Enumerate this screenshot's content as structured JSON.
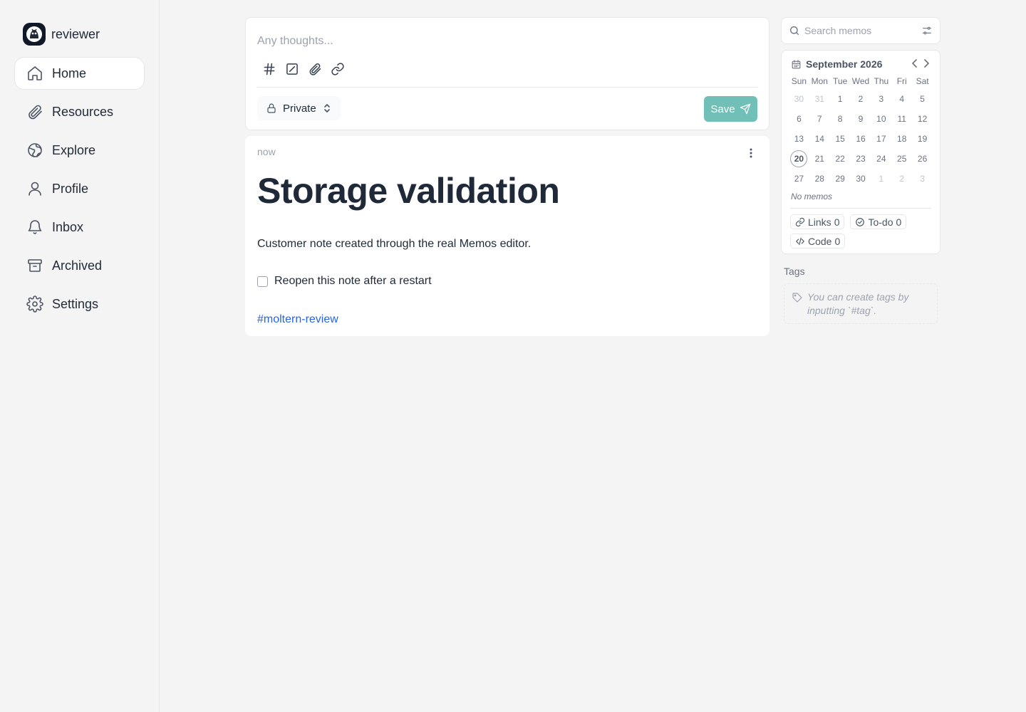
{
  "user": {
    "name": "reviewer"
  },
  "nav": {
    "items": [
      {
        "label": "Home",
        "icon": "home-icon",
        "active": true
      },
      {
        "label": "Resources",
        "icon": "paperclip-icon"
      },
      {
        "label": "Explore",
        "icon": "globe-icon"
      },
      {
        "label": "Profile",
        "icon": "user-icon"
      },
      {
        "label": "Inbox",
        "icon": "bell-icon"
      },
      {
        "label": "Archived",
        "icon": "archive-icon"
      },
      {
        "label": "Settings",
        "icon": "gear-icon"
      }
    ]
  },
  "editor": {
    "placeholder": "Any thoughts...",
    "visibility": "Private",
    "save_label": "Save"
  },
  "memo": {
    "time": "now",
    "title": "Storage validation",
    "body": "Customer note created through the real Memos editor.",
    "task": "Reopen this note after a restart",
    "task_checked": false,
    "tag": "#moltern-review"
  },
  "search": {
    "placeholder": "Search memos"
  },
  "calendar": {
    "month_label": "September 2026",
    "weekdays": [
      "Sun",
      "Mon",
      "Tue",
      "Wed",
      "Thu",
      "Fri",
      "Sat"
    ],
    "weeks": [
      [
        "30",
        "31",
        "1",
        "2",
        "3",
        "4",
        "5"
      ],
      [
        "6",
        "7",
        "8",
        "9",
        "10",
        "11",
        "12"
      ],
      [
        "13",
        "14",
        "15",
        "16",
        "17",
        "18",
        "19"
      ],
      [
        "20",
        "21",
        "22",
        "23",
        "24",
        "25",
        "26"
      ],
      [
        "27",
        "28",
        "29",
        "30",
        "1",
        "2",
        "3"
      ]
    ],
    "today": "20",
    "no_memos": "No memos"
  },
  "stats": {
    "links_label": "Links",
    "links_count": "0",
    "todo_label": "To-do",
    "todo_count": "0",
    "code_label": "Code",
    "code_count": "0"
  },
  "tags": {
    "label": "Tags",
    "empty_hint": "You can create tags by inputting `#tag`."
  },
  "colors": {
    "accent": "#70c0b8",
    "tag_link": "#2563eb",
    "background": "#f4f4f5"
  }
}
